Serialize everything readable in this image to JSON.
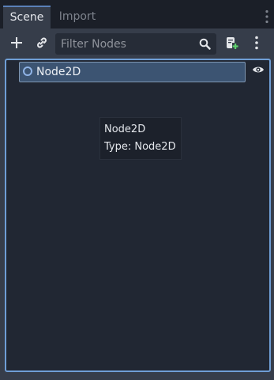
{
  "tabs": [
    {
      "label": "Scene",
      "active": true
    },
    {
      "label": "Import",
      "active": false
    }
  ],
  "toolbar": {
    "add_icon": "plus-icon",
    "link_icon": "link-icon",
    "filter_placeholder": "Filter Nodes",
    "search_icon": "search-icon",
    "script_icon": "attach-script-icon",
    "menu_icon": "kebab-menu-icon"
  },
  "tree": {
    "nodes": [
      {
        "label": "Node2D",
        "icon": "node2d-icon",
        "selected": true,
        "visible": true
      }
    ]
  },
  "tooltip": {
    "line1": "Node2D",
    "line2": "Type: Node2D"
  },
  "colors": {
    "accent": "#6f9ed6",
    "selection": "#3c5472",
    "panel": "#363d4a",
    "tree_bg": "#212733"
  }
}
